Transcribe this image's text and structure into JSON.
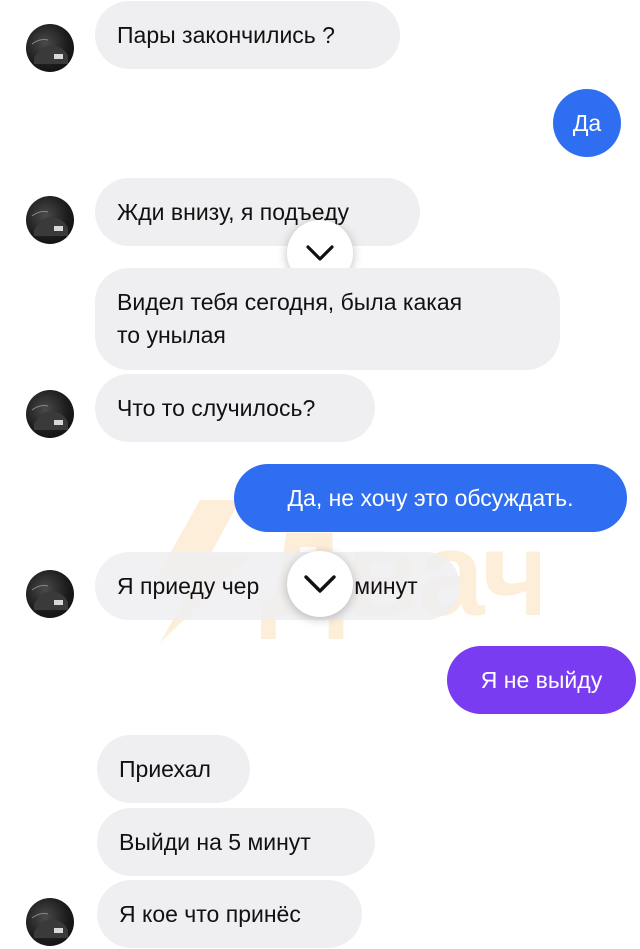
{
  "watermark": {
    "text": "Двач",
    "icon": "lightning-icon",
    "color": "#f39a1f"
  },
  "colors": {
    "incoming": "#efeff1",
    "outgoing_blue": "#2f6ef0",
    "outgoing_purple": "#7a3cf0"
  },
  "messages": [
    {
      "from": "them",
      "text": "Пары закончились ?"
    },
    {
      "from": "me",
      "text": "Да"
    },
    {
      "from": "them",
      "text": "Жди внизу, я подъеду"
    },
    {
      "from": "them",
      "text": "Видел тебя сегодня, была какая то  унылая"
    },
    {
      "from": "them",
      "text": "Что то случилось?"
    },
    {
      "from": "me",
      "text": "Да, не хочу это обсуждать."
    },
    {
      "from": "them",
      "text": "Я приеду чер",
      "text_after": "минут"
    },
    {
      "from": "me",
      "text": "Я не выйду"
    },
    {
      "from": "them",
      "text": "Приехал"
    },
    {
      "from": "them",
      "text": "Выйди на 5 минут"
    },
    {
      "from": "them",
      "text": "Я кое что принёс"
    }
  ],
  "message3_lines": [
    "Видел тебя сегодня, была какая",
    "то  унылая"
  ],
  "scroll_down_icon": "chevron-down-icon"
}
